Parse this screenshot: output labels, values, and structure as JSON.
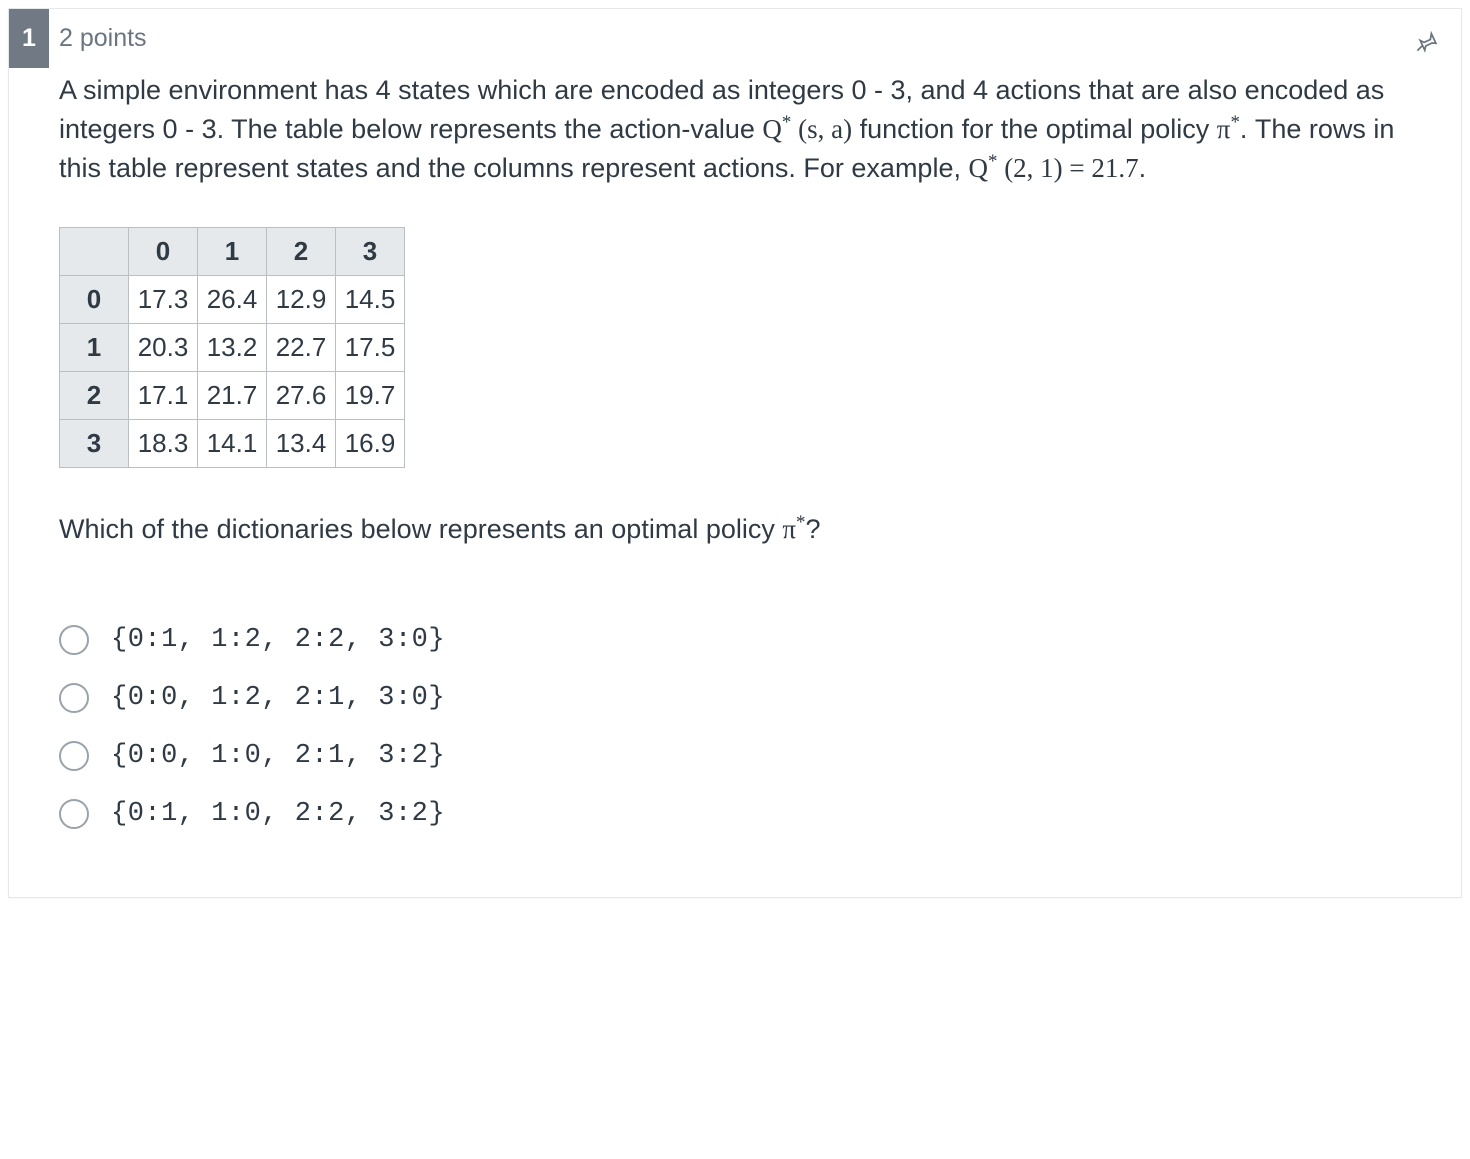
{
  "question_number": "1",
  "points_label": "2 points",
  "prompt_html": "A simple environment has 4 states which are encoded as integers 0 - 3, and 4 actions that are also encoded as integers 0 - 3. The table below represents the action-value <span class='math'>Q<span class='sup'>*</span> (s, a)</span> function for the optimal policy <span class='math'>π<span class='sup'>*</span></span>. The rows in this table represent states and the columns represent actions. For example, <span class='math'>Q<span class='sup'>*</span> (2, 1) = 21.7</span>.",
  "table": {
    "col_headers": [
      "0",
      "1",
      "2",
      "3"
    ],
    "row_headers": [
      "0",
      "1",
      "2",
      "3"
    ],
    "rows": [
      [
        "17.3",
        "26.4",
        "12.9",
        "14.5"
      ],
      [
        "20.3",
        "13.2",
        "22.7",
        "17.5"
      ],
      [
        "17.1",
        "21.7",
        "27.6",
        "19.7"
      ],
      [
        "18.3",
        "14.1",
        "13.4",
        "16.9"
      ]
    ]
  },
  "question_html": "Which of the dictionaries below represents an optimal policy <span class='math'>π<span class='sup'>*</span></span>?",
  "options": [
    "{0:1, 1:2, 2:2, 3:0}",
    "{0:0, 1:2, 2:1, 3:0}",
    "{0:0, 1:0, 2:1, 3:2}",
    "{0:1, 1:0, 2:2, 3:2}"
  ]
}
